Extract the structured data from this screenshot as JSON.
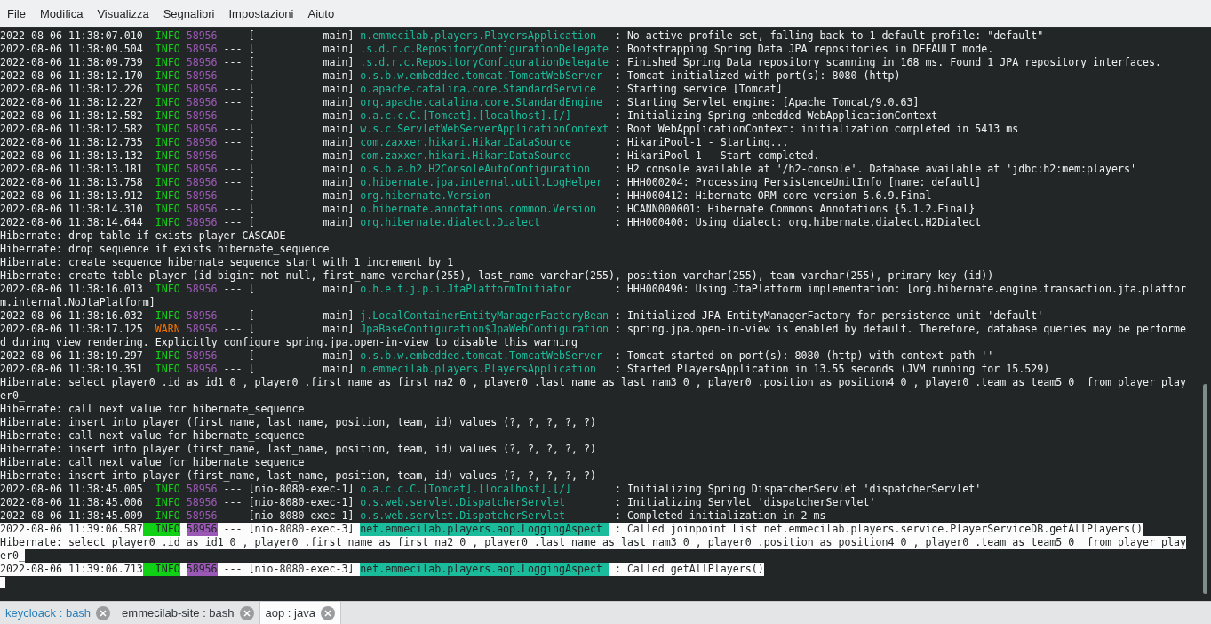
{
  "menu": [
    {
      "label": "File"
    },
    {
      "label": "Modifica"
    },
    {
      "label": "Visualizza"
    },
    {
      "label": "Segnalibri"
    },
    {
      "label": "Impostazioni"
    },
    {
      "label": "Aiuto"
    }
  ],
  "lines": [
    {
      "kind": "log",
      "timestamp": "2022-08-06 11:38:07.010",
      "level": "INFO",
      "color": "#11d116",
      "pid": "58956",
      "separator": "---",
      "thread": "[           main]",
      "logger": "n.emmecilab.players.PlayersApplication",
      "message": ": No active profile set, falling back to 1 default profile: \"default\"",
      "selected": false
    },
    {
      "kind": "log",
      "timestamp": "2022-08-06 11:38:09.504",
      "level": "INFO",
      "color": "#11d116",
      "pid": "58956",
      "separator": "---",
      "thread": "[           main]",
      "logger": ".s.d.r.c.RepositoryConfigurationDelegate",
      "message": ": Bootstrapping Spring Data JPA repositories in DEFAULT mode.",
      "selected": false
    },
    {
      "kind": "log",
      "timestamp": "2022-08-06 11:38:09.739",
      "level": "INFO",
      "color": "#11d116",
      "pid": "58956",
      "separator": "---",
      "thread": "[           main]",
      "logger": ".s.d.r.c.RepositoryConfigurationDelegate",
      "message": ": Finished Spring Data repository scanning in 168 ms. Found 1 JPA repository interfaces.",
      "selected": false
    },
    {
      "kind": "log",
      "timestamp": "2022-08-06 11:38:12.170",
      "level": "INFO",
      "color": "#11d116",
      "pid": "58956",
      "separator": "---",
      "thread": "[           main]",
      "logger": "o.s.b.w.embedded.tomcat.TomcatWebServer",
      "message": ": Tomcat initialized with port(s): 8080 (http)",
      "selected": false
    },
    {
      "kind": "log",
      "timestamp": "2022-08-06 11:38:12.226",
      "level": "INFO",
      "color": "#11d116",
      "pid": "58956",
      "separator": "---",
      "thread": "[           main]",
      "logger": "o.apache.catalina.core.StandardService",
      "message": ": Starting service [Tomcat]",
      "selected": false
    },
    {
      "kind": "log",
      "timestamp": "2022-08-06 11:38:12.227",
      "level": "INFO",
      "color": "#11d116",
      "pid": "58956",
      "separator": "---",
      "thread": "[           main]",
      "logger": "org.apache.catalina.core.StandardEngine",
      "message": ": Starting Servlet engine: [Apache Tomcat/9.0.63]",
      "selected": false
    },
    {
      "kind": "log",
      "timestamp": "2022-08-06 11:38:12.582",
      "level": "INFO",
      "color": "#11d116",
      "pid": "58956",
      "separator": "---",
      "thread": "[           main]",
      "logger": "o.a.c.c.C.[Tomcat].[localhost].[/]",
      "message": ": Initializing Spring embedded WebApplicationContext",
      "selected": false
    },
    {
      "kind": "log",
      "timestamp": "2022-08-06 11:38:12.582",
      "level": "INFO",
      "color": "#11d116",
      "pid": "58956",
      "separator": "---",
      "thread": "[           main]",
      "logger": "w.s.c.ServletWebServerApplicationContext",
      "message": ": Root WebApplicationContext: initialization completed in 5413 ms",
      "selected": false
    },
    {
      "kind": "log",
      "timestamp": "2022-08-06 11:38:12.735",
      "level": "INFO",
      "color": "#11d116",
      "pid": "58956",
      "separator": "---",
      "thread": "[           main]",
      "logger": "com.zaxxer.hikari.HikariDataSource",
      "message": ": HikariPool-1 - Starting...",
      "selected": false
    },
    {
      "kind": "log",
      "timestamp": "2022-08-06 11:38:13.132",
      "level": "INFO",
      "color": "#11d116",
      "pid": "58956",
      "separator": "---",
      "thread": "[           main]",
      "logger": "com.zaxxer.hikari.HikariDataSource",
      "message": ": HikariPool-1 - Start completed.",
      "selected": false
    },
    {
      "kind": "log",
      "timestamp": "2022-08-06 11:38:13.181",
      "level": "INFO",
      "color": "#11d116",
      "pid": "58956",
      "separator": "---",
      "thread": "[           main]",
      "logger": "o.s.b.a.h2.H2ConsoleAutoConfiguration",
      "message": ": H2 console available at '/h2-console'. Database available at 'jdbc:h2:mem:players'",
      "selected": false
    },
    {
      "kind": "log",
      "timestamp": "2022-08-06 11:38:13.758",
      "level": "INFO",
      "color": "#11d116",
      "pid": "58956",
      "separator": "---",
      "thread": "[           main]",
      "logger": "o.hibernate.jpa.internal.util.LogHelper",
      "message": ": HHH000204: Processing PersistenceUnitInfo [name: default]",
      "selected": false
    },
    {
      "kind": "log",
      "timestamp": "2022-08-06 11:38:13.912",
      "level": "INFO",
      "color": "#11d116",
      "pid": "58956",
      "separator": "---",
      "thread": "[           main]",
      "logger": "org.hibernate.Version",
      "message": ": HHH000412: Hibernate ORM core version 5.6.9.Final",
      "selected": false
    },
    {
      "kind": "log",
      "timestamp": "2022-08-06 11:38:14.310",
      "level": "INFO",
      "color": "#11d116",
      "pid": "58956",
      "separator": "---",
      "thread": "[           main]",
      "logger": "o.hibernate.annotations.common.Version",
      "message": ": HCANN000001: Hibernate Commons Annotations {5.1.2.Final}",
      "selected": false
    },
    {
      "kind": "log",
      "timestamp": "2022-08-06 11:38:14.644",
      "level": "INFO",
      "color": "#11d116",
      "pid": "58956",
      "separator": "---",
      "thread": "[           main]",
      "logger": "org.hibernate.dialect.Dialect",
      "message": ": HHH000400: Using dialect: org.hibernate.dialect.H2Dialect",
      "selected": false
    },
    {
      "kind": "text",
      "text": "Hibernate: drop table if exists player CASCADE",
      "selected": false
    },
    {
      "kind": "text",
      "text": "Hibernate: drop sequence if exists hibernate_sequence",
      "selected": false
    },
    {
      "kind": "text",
      "text": "Hibernate: create sequence hibernate_sequence start with 1 increment by 1",
      "selected": false
    },
    {
      "kind": "text",
      "text": "Hibernate: create table player (id bigint not null, first_name varchar(255), last_name varchar(255), position varchar(255), team varchar(255), primary key (id))",
      "selected": false
    },
    {
      "kind": "log",
      "timestamp": "2022-08-06 11:38:16.013",
      "level": "INFO",
      "color": "#11d116",
      "pid": "58956",
      "separator": "---",
      "thread": "[           main]",
      "logger": "o.h.e.t.j.p.i.JtaPlatformInitiator",
      "message": ": HHH000490: Using JtaPlatform implementation: [org.hibernate.engine.transaction.jta.platfor",
      "selected": false
    },
    {
      "kind": "text",
      "text": "m.internal.NoJtaPlatform]",
      "selected": false
    },
    {
      "kind": "log",
      "timestamp": "2022-08-06 11:38:16.032",
      "level": "INFO",
      "color": "#11d116",
      "pid": "58956",
      "separator": "---",
      "thread": "[           main]",
      "logger": "j.LocalContainerEntityManagerFactoryBean",
      "message": ": Initialized JPA EntityManagerFactory for persistence unit 'default'",
      "selected": false
    },
    {
      "kind": "log",
      "timestamp": "2022-08-06 11:38:17.125",
      "level": "WARN",
      "color": "#f67400",
      "pid": "58956",
      "separator": "---",
      "thread": "[           main]",
      "logger": "JpaBaseConfiguration$JpaWebConfiguration",
      "message": ": spring.jpa.open-in-view is enabled by default. Therefore, database queries may be performe",
      "selected": false
    },
    {
      "kind": "text",
      "text": "d during view rendering. Explicitly configure spring.jpa.open-in-view to disable this warning",
      "selected": false
    },
    {
      "kind": "log",
      "timestamp": "2022-08-06 11:38:19.297",
      "level": "INFO",
      "color": "#11d116",
      "pid": "58956",
      "separator": "---",
      "thread": "[           main]",
      "logger": "o.s.b.w.embedded.tomcat.TomcatWebServer",
      "message": ": Tomcat started on port(s): 8080 (http) with context path ''",
      "selected": false
    },
    {
      "kind": "log",
      "timestamp": "2022-08-06 11:38:19.351",
      "level": "INFO",
      "color": "#11d116",
      "pid": "58956",
      "separator": "---",
      "thread": "[           main]",
      "logger": "n.emmecilab.players.PlayersApplication",
      "message": ": Started PlayersApplication in 13.55 seconds (JVM running for 15.529)",
      "selected": false
    },
    {
      "kind": "text",
      "text": "Hibernate: select player0_.id as id1_0_, player0_.first_name as first_na2_0_, player0_.last_name as last_nam3_0_, player0_.position as position4_0_, player0_.team as team5_0_ from player play",
      "selected": false
    },
    {
      "kind": "text",
      "text": "er0_",
      "selected": false
    },
    {
      "kind": "text",
      "text": "Hibernate: call next value for hibernate_sequence",
      "selected": false
    },
    {
      "kind": "text",
      "text": "Hibernate: insert into player (first_name, last_name, position, team, id) values (?, ?, ?, ?, ?)",
      "selected": false
    },
    {
      "kind": "text",
      "text": "Hibernate: call next value for hibernate_sequence",
      "selected": false
    },
    {
      "kind": "text",
      "text": "Hibernate: insert into player (first_name, last_name, position, team, id) values (?, ?, ?, ?, ?)",
      "selected": false
    },
    {
      "kind": "text",
      "text": "Hibernate: call next value for hibernate_sequence",
      "selected": false
    },
    {
      "kind": "text",
      "text": "Hibernate: insert into player (first_name, last_name, position, team, id) values (?, ?, ?, ?, ?)",
      "selected": false
    },
    {
      "kind": "log",
      "timestamp": "2022-08-06 11:38:45.005",
      "level": "INFO",
      "color": "#11d116",
      "pid": "58956",
      "separator": "---",
      "thread": "[nio-8080-exec-1]",
      "logger": "o.a.c.c.C.[Tomcat].[localhost].[/]",
      "message": ": Initializing Spring DispatcherServlet 'dispatcherServlet'",
      "selected": false
    },
    {
      "kind": "log",
      "timestamp": "2022-08-06 11:38:45.006",
      "level": "INFO",
      "color": "#11d116",
      "pid": "58956",
      "separator": "---",
      "thread": "[nio-8080-exec-1]",
      "logger": "o.s.web.servlet.DispatcherServlet",
      "message": ": Initializing Servlet 'dispatcherServlet'",
      "selected": false
    },
    {
      "kind": "log",
      "timestamp": "2022-08-06 11:38:45.009",
      "level": "INFO",
      "color": "#11d116",
      "pid": "58956",
      "separator": "---",
      "thread": "[nio-8080-exec-1]",
      "logger": "o.s.web.servlet.DispatcherServlet",
      "message": ": Completed initialization in 2 ms",
      "selected": false
    },
    {
      "kind": "log",
      "timestamp": "2022-08-06 11:39:06.587",
      "level": "INFO",
      "color": "#11d116",
      "pid": "58956",
      "separator": "---",
      "thread": "[nio-8080-exec-3]",
      "logger": "net.emmecilab.players.aop.LoggingAspect",
      "message": ": Called joinpoint List net.emmecilab.players.service.PlayerServiceDB.getAllPlayers()",
      "selected": true
    },
    {
      "kind": "text",
      "text": "Hibernate: select player0_.id as id1_0_, player0_.first_name as first_na2_0_, player0_.last_name as last_nam3_0_, player0_.position as position4_0_, player0_.team as team5_0_ from player play",
      "selected": true
    },
    {
      "kind": "text",
      "text": "er0_",
      "selected": true
    },
    {
      "kind": "log",
      "timestamp": "2022-08-06 11:39:06.713",
      "level": "INFO",
      "color": "#11d116",
      "pid": "58956",
      "separator": "---",
      "thread": "[nio-8080-exec-3]",
      "logger": "net.emmecilab.players.aop.LoggingAspect",
      "message": ": Called getAllPlayers()",
      "selected": true
    }
  ],
  "tabs": [
    {
      "label": "keycloack : bash",
      "activity": true,
      "selected": false
    },
    {
      "label": "emmecilab-site : bash",
      "activity": false,
      "selected": false
    },
    {
      "label": "aop : java",
      "activity": false,
      "selected": true
    }
  ]
}
